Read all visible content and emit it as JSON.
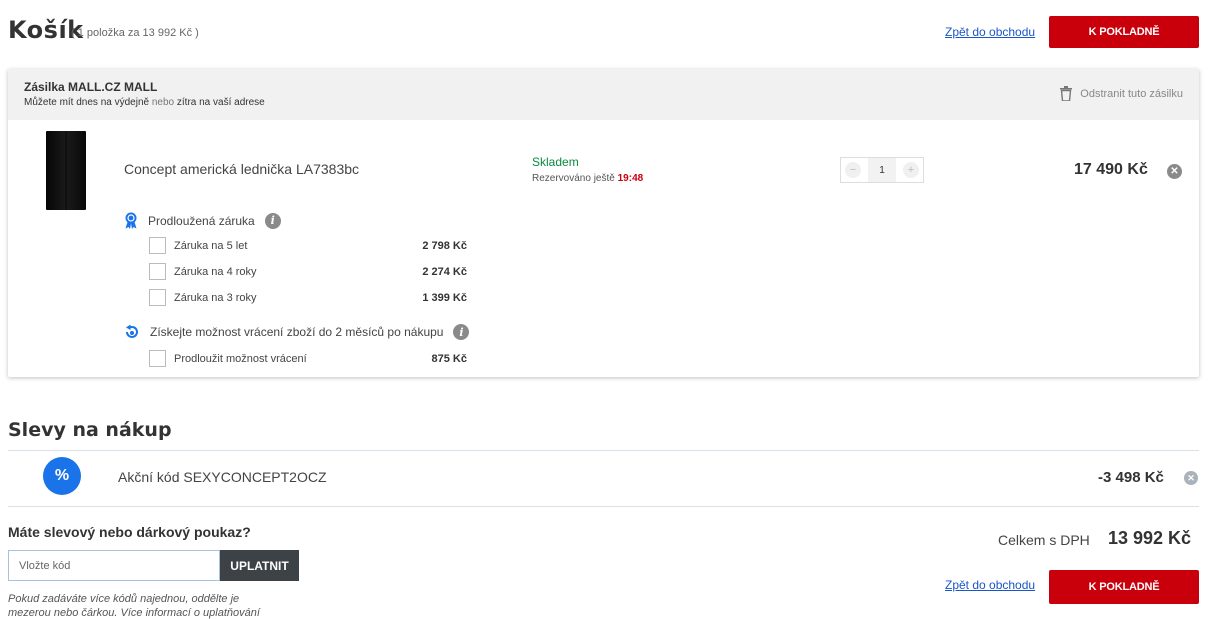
{
  "header": {
    "title": "Košík",
    "item_count": "( 1 položka za 13 992 Kč )",
    "back_link": "Zpět do obchodu",
    "checkout_label": "K POKLADNĚ"
  },
  "shipment": {
    "title": "Zásilka MALL.CZ MALL",
    "sub_part1": "Můžete mít dnes na výdejně",
    "sub_or": "nebo",
    "sub_part2": "zítra na vaší adrese",
    "remove_label": "Odstranit tuto zásilku",
    "product": {
      "name": "Concept americká lednička LA7383bc",
      "stock": "Skladem",
      "reserved_label": "Rezervováno ještě",
      "reserved_time": "19:48",
      "quantity": "1",
      "qty_minus": "−",
      "qty_plus": "+",
      "price": "17 490 Kč",
      "remove_glyph": "✕"
    },
    "warranty": {
      "title": "Prodloužená záruka",
      "info_glyph": "i",
      "options": [
        {
          "label": "Záruka na 5 let",
          "price": "2 798 Kč"
        },
        {
          "label": "Záruka na 4 roky",
          "price": "2 274 Kč"
        },
        {
          "label": "Záruka na 3 roky",
          "price": "1 399 Kč"
        }
      ]
    },
    "returns": {
      "title": "Získejte možnost vrácení zboží do 2 měsíců po nákupu",
      "info_glyph": "i",
      "option": {
        "label": "Prodloužit možnost vrácení",
        "price": "875 Kč"
      }
    }
  },
  "discounts": {
    "title": "Slevy na nákup",
    "promo_icon": "%",
    "promo_name": "Akční kód SEXYCONCEPT2OCZ",
    "promo_amount": "-3 498 Kč",
    "promo_remove_glyph": "✕"
  },
  "voucher": {
    "title": "Máte slevový nebo dárkový poukaz?",
    "placeholder": "Vložte kód",
    "apply_label": "UPLATNIT",
    "help_line1": "Pokud zadáváte více kódů najednou, oddělte je",
    "help_line2": "mezerou nebo čárkou. Více informací o uplatňování"
  },
  "totals": {
    "label": "Celkem s DPH",
    "value": "13 992 Kč"
  },
  "colors": {
    "accent_red": "#c9000c",
    "link_blue": "#1a55c9",
    "stock_green": "#0a8a3e",
    "promo_blue": "#1a73e8"
  }
}
